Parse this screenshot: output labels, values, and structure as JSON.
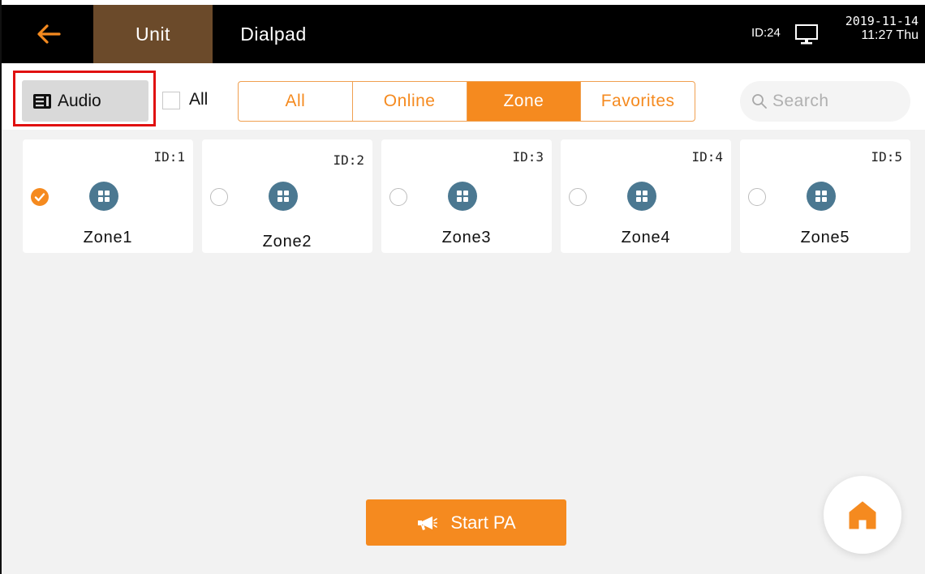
{
  "header": {
    "tabs": [
      {
        "label": "Unit",
        "active": true
      },
      {
        "label": "Dialpad",
        "active": false
      }
    ],
    "device_id": "ID:24",
    "date": "2019-11-14",
    "time": "11:27 Thu",
    "icons": {
      "back": "arrow-left-icon",
      "device": "computer-monitor-icon"
    }
  },
  "toolbar": {
    "audio_label": "Audio",
    "select_all_label": "All",
    "filters": [
      {
        "label": "All",
        "active": false
      },
      {
        "label": "Online",
        "active": false
      },
      {
        "label": "Zone",
        "active": true
      },
      {
        "label": "Favorites",
        "active": false
      }
    ],
    "search_placeholder": "Search"
  },
  "zones": [
    {
      "id": "ID:1",
      "name": "Zone1",
      "selected": true
    },
    {
      "id": "ID:2",
      "name": "Zone2",
      "selected": false
    },
    {
      "id": "ID:3",
      "name": "Zone3",
      "selected": false
    },
    {
      "id": "ID:4",
      "name": "Zone4",
      "selected": false
    },
    {
      "id": "ID:5",
      "name": "Zone5",
      "selected": false
    }
  ],
  "actions": {
    "start_pa_label": "Start PA"
  },
  "colors": {
    "accent": "#f58a1f",
    "header_bg": "#000000",
    "active_tab_bg": "#6b4a2a",
    "zone_icon_bg": "#4b7891",
    "highlight_border": "#e01010"
  }
}
